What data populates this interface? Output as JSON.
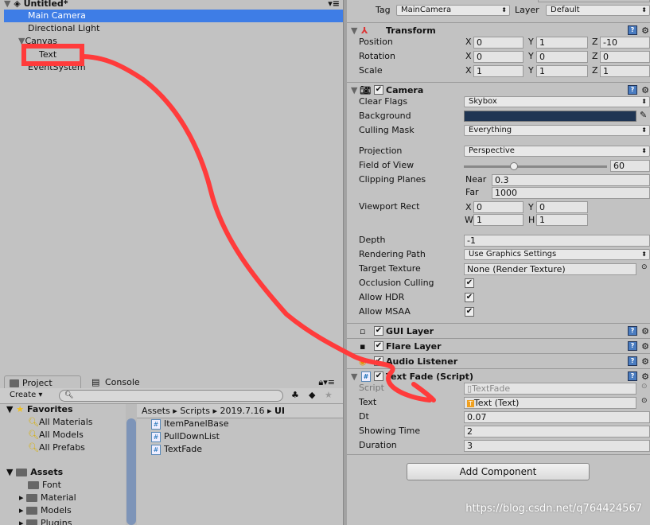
{
  "hierarchy": {
    "scene": "Untitled*",
    "items": [
      "Main Camera",
      "Directional Light",
      "Canvas",
      "Text",
      "EventSystem"
    ]
  },
  "project": {
    "tabs": [
      "Project",
      "Console"
    ],
    "create": "Create",
    "favorites": {
      "label": "Favorites",
      "items": [
        "All Materials",
        "All Models",
        "All Prefabs"
      ]
    },
    "assets": {
      "label": "Assets",
      "items": [
        "Font",
        "Material",
        "Models",
        "Plugins"
      ]
    },
    "breadcrumb": [
      "Assets",
      "Scripts",
      "2019.7.16",
      "UI"
    ],
    "files": [
      "ItemPanelBase",
      "PullDownList",
      "TextFade"
    ]
  },
  "inspector": {
    "tag_label": "Tag",
    "tag": "MainCamera",
    "layer_label": "Layer",
    "layer": "Default",
    "transform": {
      "title": "Transform",
      "rows": [
        {
          "label": "Position",
          "x": "0",
          "y": "1",
          "z": "-10"
        },
        {
          "label": "Rotation",
          "x": "0",
          "y": "0",
          "z": "0"
        },
        {
          "label": "Scale",
          "x": "1",
          "y": "1",
          "z": "1"
        }
      ]
    },
    "camera": {
      "title": "Camera",
      "clear_flags": {
        "label": "Clear Flags",
        "value": "Skybox"
      },
      "background": {
        "label": "Background",
        "color": "#1f3553"
      },
      "culling": {
        "label": "Culling Mask",
        "value": "Everything"
      },
      "projection": {
        "label": "Projection",
        "value": "Perspective"
      },
      "fov": {
        "label": "Field of View",
        "value": "60",
        "fraction": 0.35
      },
      "clipping": {
        "label": "Clipping Planes",
        "near_label": "Near",
        "near": "0.3",
        "far_label": "Far",
        "far": "1000"
      },
      "viewport": {
        "label": "Viewport Rect",
        "x": "0",
        "y": "0",
        "w": "1",
        "h": "1"
      },
      "depth": {
        "label": "Depth",
        "value": "-1"
      },
      "rendering": {
        "label": "Rendering Path",
        "value": "Use Graphics Settings"
      },
      "target": {
        "label": "Target Texture",
        "value": "None (Render Texture)"
      },
      "occlusion": "Occlusion Culling",
      "hdr": "Allow HDR",
      "msaa": "Allow MSAA"
    },
    "components": [
      "GUI Layer",
      "Flare Layer",
      "Audio Listener"
    ],
    "textfade": {
      "title": "Text Fade (Script)",
      "script": {
        "label": "Script",
        "value": "TextFade"
      },
      "text": {
        "label": "Text",
        "value": "Text (Text)"
      },
      "dt": {
        "label": "Dt",
        "value": "0.07"
      },
      "showing": {
        "label": "Showing Time",
        "value": "2"
      },
      "duration": {
        "label": "Duration",
        "value": "3"
      }
    },
    "add_component": "Add Component"
  },
  "watermark": "https://blog.csdn.net/q764424567",
  "annotation_color": "#ff3b3b"
}
